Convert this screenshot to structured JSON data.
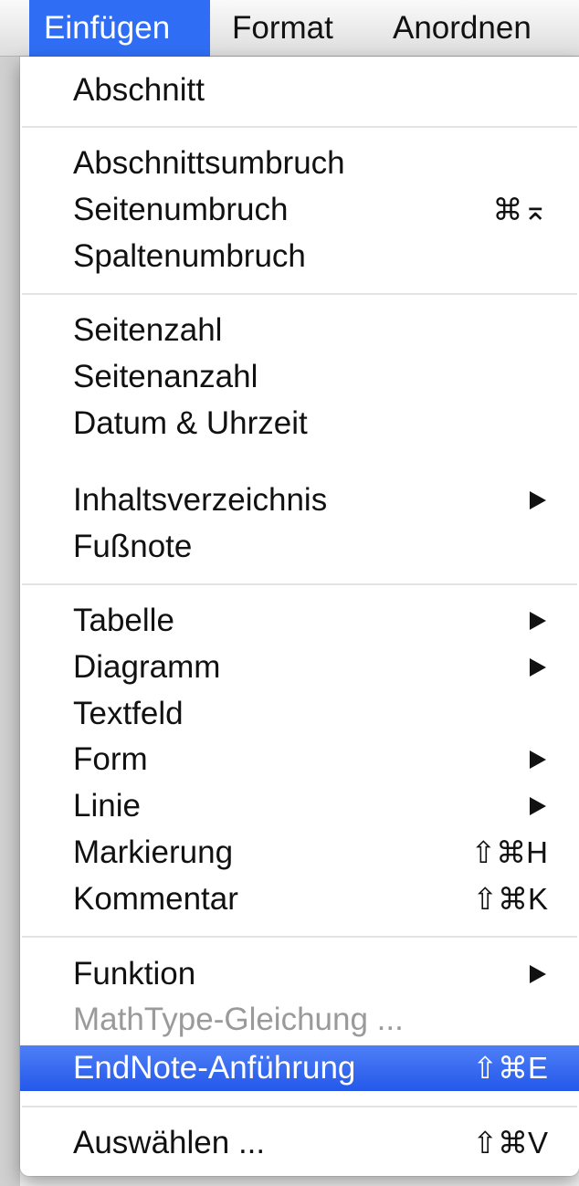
{
  "menubar": {
    "items": [
      {
        "label": "Einfügen"
      },
      {
        "label": "Format"
      },
      {
        "label": "Anordnen"
      }
    ]
  },
  "menu": {
    "items": [
      {
        "label": "Abschnitt",
        "shortcut": ""
      },
      {
        "label": "Abschnittsumbruch",
        "shortcut": ""
      },
      {
        "label": "Seitenumbruch",
        "shortcut": "⌘⌅"
      },
      {
        "label": "Spaltenumbruch",
        "shortcut": ""
      },
      {
        "label": "Seitenzahl",
        "shortcut": ""
      },
      {
        "label": "Seitenanzahl",
        "shortcut": ""
      },
      {
        "label": "Datum & Uhrzeit",
        "shortcut": ""
      },
      {
        "label": "Inhaltsverzeichnis",
        "shortcut": ""
      },
      {
        "label": "Fußnote",
        "shortcut": ""
      },
      {
        "label": "Tabelle",
        "shortcut": ""
      },
      {
        "label": "Diagramm",
        "shortcut": ""
      },
      {
        "label": "Textfeld",
        "shortcut": ""
      },
      {
        "label": "Form",
        "shortcut": ""
      },
      {
        "label": "Linie",
        "shortcut": ""
      },
      {
        "label": "Markierung",
        "shortcut": "⇧⌘H"
      },
      {
        "label": "Kommentar",
        "shortcut": "⇧⌘K"
      },
      {
        "label": "Funktion",
        "shortcut": ""
      },
      {
        "label": "MathType-Gleichung ...",
        "shortcut": ""
      },
      {
        "label": "EndNote-Anführung",
        "shortcut": "⇧⌘E"
      },
      {
        "label": "Auswählen ...",
        "shortcut": "⇧⌘V"
      }
    ]
  },
  "colors": {
    "highlight": "#2f6ef4",
    "disabled_text": "#9a9a9a"
  }
}
